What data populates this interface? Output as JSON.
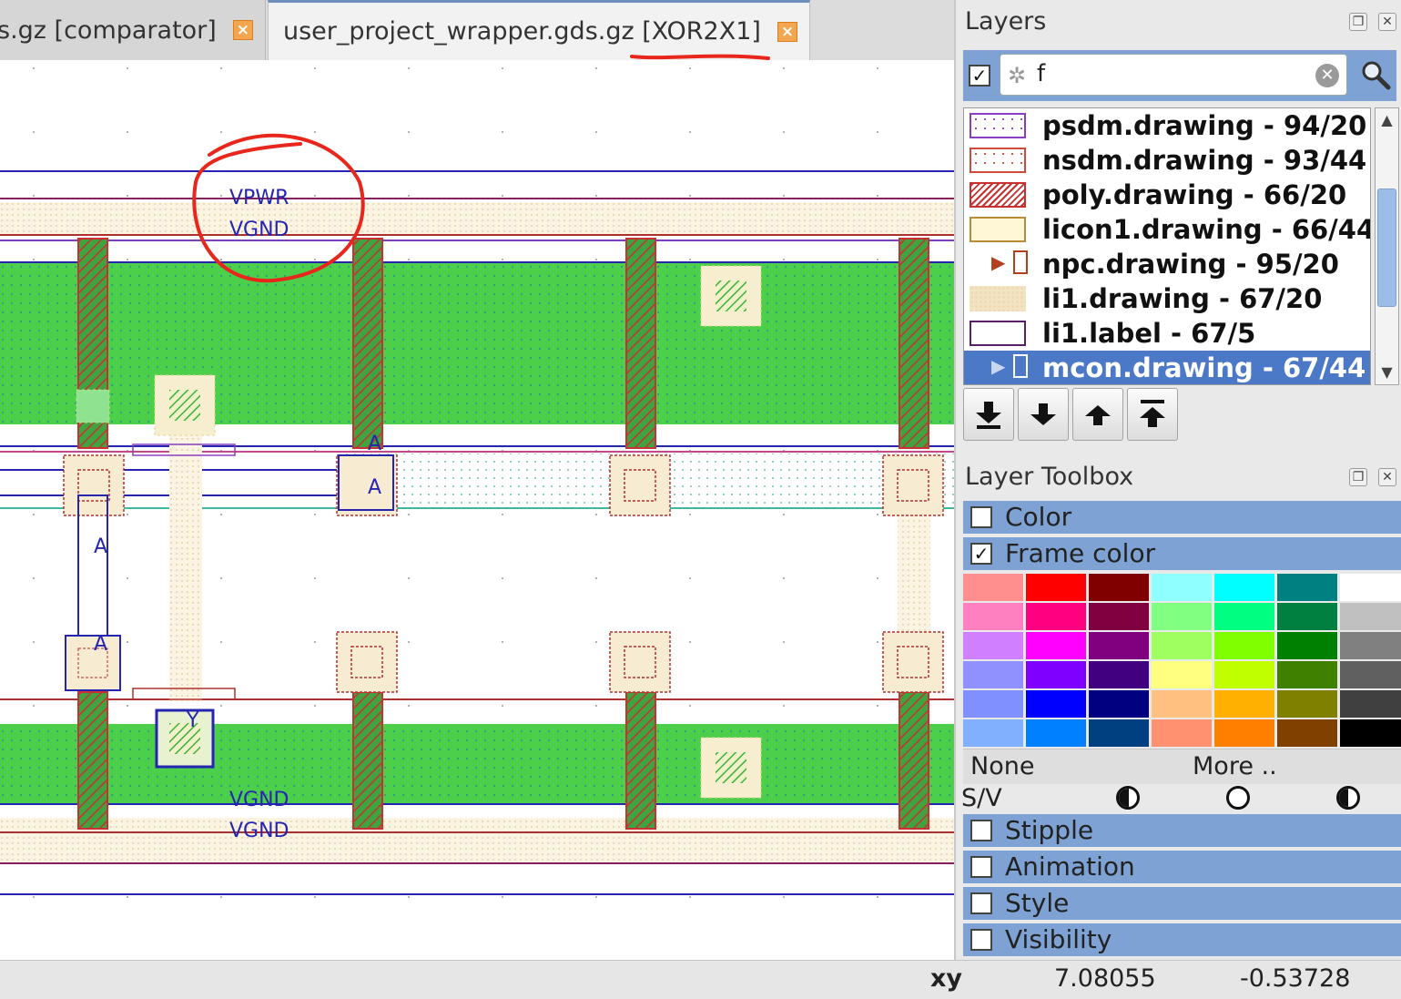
{
  "tabs": [
    {
      "label": "s.gz [comparator]",
      "active": false
    },
    {
      "label": "user_project_wrapper.gds.gz [XOR2X1]",
      "active": true
    }
  ],
  "canvas": {
    "labels": {
      "vpwr_top": "VPWR",
      "vgnd_top": "VGND",
      "vgnd_bottom_1": "VGND",
      "vgnd_bottom_2": "VGND",
      "pin_a_1": "A",
      "pin_a_2": "A",
      "pin_a_3": "A",
      "pin_a_4": "A",
      "pin_y": "Y"
    },
    "colors": {
      "well_green": "#4cd04c",
      "poly_red": "#cc2a2a",
      "li_beige": "#f7ecd2",
      "met_blue": "#2525b0",
      "annotation_red": "#e8261c"
    }
  },
  "layers_panel": {
    "title": "Layers",
    "filter": {
      "checked": true,
      "value": "f"
    },
    "layers": [
      {
        "name": "psdm.drawing - 94/20",
        "swatch": "dotted-purple",
        "color": "#8a3fbf",
        "selected": false
      },
      {
        "name": "nsdm.drawing - 93/44",
        "swatch": "dotted-red",
        "color": "#d14a3a",
        "selected": false
      },
      {
        "name": "poly.drawing - 66/20",
        "swatch": "hatched-red",
        "color": "#c8312f",
        "selected": false
      },
      {
        "name": "licon1.drawing - 66/44",
        "swatch": "solid-cream",
        "color": "#fff7d6",
        "selected": false
      },
      {
        "name": "npc.drawing - 95/20",
        "swatch": "expand-arrow",
        "color": "#b04020",
        "selected": false
      },
      {
        "name": "li1.drawing - 67/20",
        "swatch": "dotted-beige",
        "color": "#f3e3c2",
        "selected": false
      },
      {
        "name": "li1.label - 67/5",
        "swatch": "outline-purple",
        "color": "#5a1f6b",
        "selected": false
      },
      {
        "name": "mcon.drawing - 67/44",
        "swatch": "expand-arrow",
        "color": "#ffffff",
        "selected": true
      }
    ],
    "move_buttons": [
      "move-to-bottom",
      "move-down",
      "move-up",
      "move-to-top"
    ]
  },
  "toolbox": {
    "title": "Layer Toolbox",
    "color": {
      "label": "Color",
      "checked": false
    },
    "frame_color": {
      "label": "Frame color",
      "checked": true
    },
    "palette": [
      [
        "#ff8f8f",
        "#ff0000",
        "#800000",
        "#8fffff",
        "#00ffff",
        "#008080",
        "#ffffff"
      ],
      [
        "#ff80c0",
        "#ff0080",
        "#800040",
        "#80ff80",
        "#00ff80",
        "#008040",
        "#c0c0c0"
      ],
      [
        "#d080ff",
        "#ff00ff",
        "#800080",
        "#a0ff60",
        "#80ff00",
        "#008000",
        "#808080"
      ],
      [
        "#9090ff",
        "#8000ff",
        "#400080",
        "#ffff80",
        "#c0ff00",
        "#408000",
        "#606060"
      ],
      [
        "#8090ff",
        "#0000ff",
        "#000080",
        "#ffc080",
        "#ffb000",
        "#808000",
        "#404040"
      ],
      [
        "#80b0ff",
        "#0080ff",
        "#004080",
        "#ff9070",
        "#ff8000",
        "#804000",
        "#000000"
      ]
    ],
    "none_label": "None",
    "more_label": "More ..",
    "sv_label": "S/V",
    "stipple": {
      "label": "Stipple",
      "checked": false
    },
    "animation": {
      "label": "Animation",
      "checked": false
    },
    "style": {
      "label": "Style",
      "checked": false
    },
    "visibility": {
      "label": "Visibility",
      "checked": false
    }
  },
  "status": {
    "xy_label": "xy",
    "x": "7.08055",
    "y": "-0.53728"
  }
}
